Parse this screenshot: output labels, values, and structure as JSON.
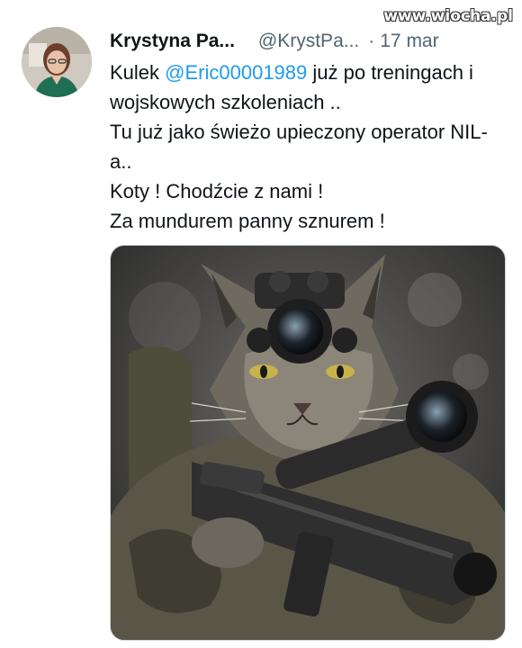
{
  "watermark": "www.wiocha.pl",
  "tweet": {
    "author": {
      "display_name": "Krystyna Pa...",
      "handle": "@KrystPa...",
      "separator": "·",
      "date": "17 mar"
    },
    "more_label": "•••",
    "text": {
      "line1_prefix": "Kulek ",
      "mention": "@Eric00001989",
      "line1_suffix": " już po treningach i wojskowych szkoleniach ..",
      "line2": "Tu już jako świeżo upieczony operator NIL-a..",
      "line3": "Koty ! Chodźcie z nami !",
      "line4": "Za mundurem panny sznurem !"
    },
    "media": {
      "kind": "photo",
      "subject": "cat-with-night-vision-goggles-and-rifle"
    }
  },
  "colors": {
    "text": "#0f1419",
    "secondary": "#536471",
    "link": "#1d9bf0",
    "border": "#cfd9de"
  }
}
